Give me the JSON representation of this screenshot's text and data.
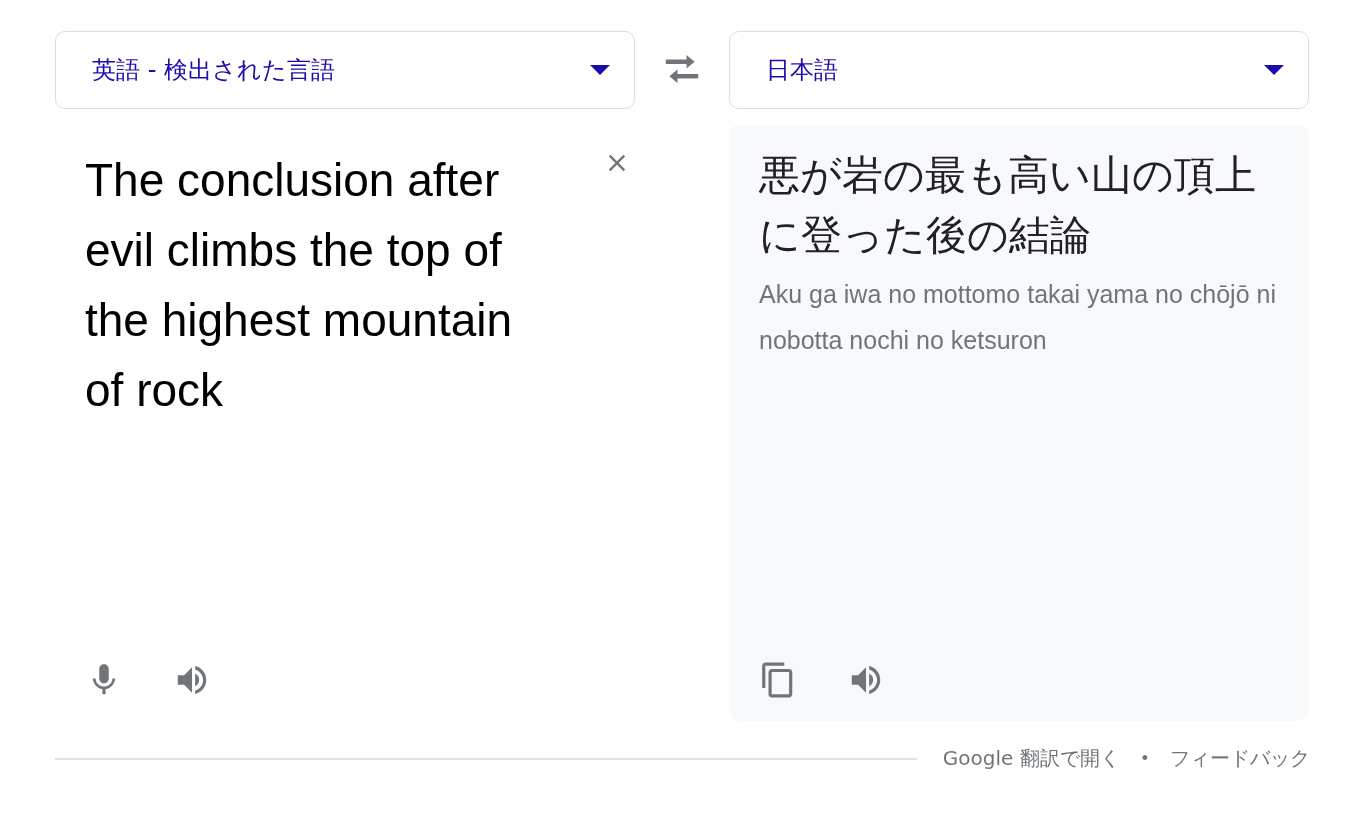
{
  "source_language": {
    "label": "英語 - 検出された言語"
  },
  "target_language": {
    "label": "日本語"
  },
  "source": {
    "text": "The conclusion after evil climbs the top of the highest mountain of rock"
  },
  "translation": {
    "text": "悪が岩の最も高い山の頂上に登った後の結論",
    "romanization": "Aku ga iwa no mottomo takai yama no chōjō ni nobotta nochi no ketsuron"
  },
  "footer": {
    "links": [
      "Google 翻訳で開く",
      "フィードバック"
    ],
    "separator": "•"
  }
}
